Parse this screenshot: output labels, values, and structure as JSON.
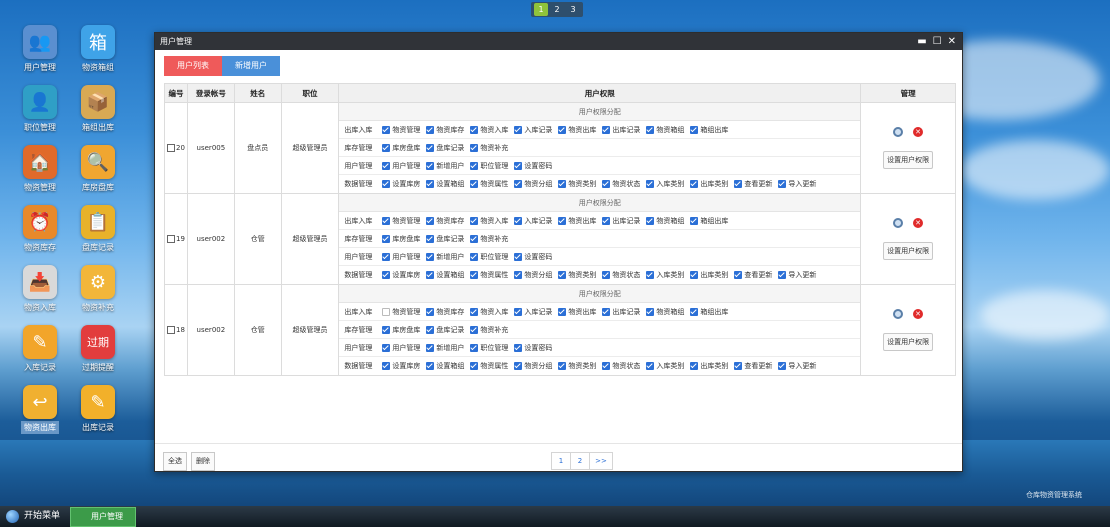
{
  "desktop": {
    "icons": [
      {
        "label": "用户管理",
        "glyph": "👥",
        "color": "#5a8fd0"
      },
      {
        "label": "物资箱组",
        "glyph": "箱",
        "color": "#3fa3e8"
      },
      {
        "label": "职位管理",
        "glyph": "👤",
        "color": "#2f9fc6"
      },
      {
        "label": "箱组出库",
        "glyph": "📦",
        "color": "#d8a954"
      },
      {
        "label": "物资管理",
        "glyph": "🏠",
        "color": "#e06a2a"
      },
      {
        "label": "库房盘库",
        "glyph": "🔍",
        "color": "#f0a630"
      },
      {
        "label": "物资库存",
        "glyph": "⏰",
        "color": "#e8892a"
      },
      {
        "label": "盘库记录",
        "glyph": "📋",
        "color": "#e8b22a"
      },
      {
        "label": "物资入库",
        "glyph": "📥",
        "color": "#d9d9d9"
      },
      {
        "label": "物资补充",
        "glyph": "⚙",
        "color": "#f2b63a"
      },
      {
        "label": "入库记录",
        "glyph": "✎",
        "color": "#f2a52a"
      },
      {
        "label": "过期提醒",
        "glyph": "过期",
        "color": "#e23d3d"
      },
      {
        "label": "物资出库",
        "glyph": "↩",
        "color": "#f0b030"
      },
      {
        "label": "出库记录",
        "glyph": "✎",
        "color": "#f2b02a"
      }
    ]
  },
  "top_pager": [
    "1",
    "2",
    "3"
  ],
  "window": {
    "title": "用户管理",
    "controls": [
      "▬",
      "☐",
      "✕"
    ],
    "tabs": [
      "用户列表",
      "新增用户"
    ],
    "headers": [
      "编号",
      "登录帐号",
      "姓名",
      "职位",
      "用户权限",
      "管理"
    ],
    "perm_title": "用户权限分配",
    "rows": [
      {
        "id": "20",
        "account": "user005",
        "name": "盘点员",
        "position": "超级管理员",
        "perms": [
          {
            "cat": "出库入库",
            "items": [
              [
                "物资管理",
                1
              ],
              [
                "物资库存",
                1
              ],
              [
                "物资入库",
                1
              ],
              [
                "入库记录",
                1
              ],
              [
                "物资出库",
                1
              ],
              [
                "出库记录",
                1
              ],
              [
                "物资箱组",
                1
              ],
              [
                "箱组出库",
                1
              ]
            ]
          },
          {
            "cat": "库存管理",
            "items": [
              [
                "库房盘库",
                1
              ],
              [
                "盘库记录",
                1
              ],
              [
                "物资补充",
                1
              ]
            ]
          },
          {
            "cat": "用户管理",
            "items": [
              [
                "用户管理",
                1
              ],
              [
                "新增用户",
                1
              ],
              [
                "职位管理",
                1
              ],
              [
                "设置密码",
                1
              ]
            ]
          },
          {
            "cat": "数据管理",
            "items": [
              [
                "设置库房",
                1
              ],
              [
                "设置箱组",
                1
              ],
              [
                "物资属性",
                1
              ],
              [
                "物资分组",
                1
              ],
              [
                "物资类别",
                1
              ],
              [
                "物资状态",
                1
              ],
              [
                "入库类别",
                1
              ],
              [
                "出库类别",
                1
              ],
              [
                "查看更新",
                1
              ],
              [
                "导入更新",
                1
              ]
            ]
          }
        ]
      },
      {
        "id": "19",
        "account": "user002",
        "name": "仓管",
        "position": "超级管理员",
        "perms": [
          {
            "cat": "出库入库",
            "items": [
              [
                "物资管理",
                1
              ],
              [
                "物资库存",
                1
              ],
              [
                "物资入库",
                1
              ],
              [
                "入库记录",
                1
              ],
              [
                "物资出库",
                1
              ],
              [
                "出库记录",
                1
              ],
              [
                "物资箱组",
                1
              ],
              [
                "箱组出库",
                1
              ]
            ]
          },
          {
            "cat": "库存管理",
            "items": [
              [
                "库房盘库",
                1
              ],
              [
                "盘库记录",
                1
              ],
              [
                "物资补充",
                1
              ]
            ]
          },
          {
            "cat": "用户管理",
            "items": [
              [
                "用户管理",
                1
              ],
              [
                "新增用户",
                1
              ],
              [
                "职位管理",
                1
              ],
              [
                "设置密码",
                1
              ]
            ]
          },
          {
            "cat": "数据管理",
            "items": [
              [
                "设置库房",
                1
              ],
              [
                "设置箱组",
                1
              ],
              [
                "物资属性",
                1
              ],
              [
                "物资分组",
                1
              ],
              [
                "物资类别",
                1
              ],
              [
                "物资状态",
                1
              ],
              [
                "入库类别",
                1
              ],
              [
                "出库类别",
                1
              ],
              [
                "查看更新",
                1
              ],
              [
                "导入更新",
                1
              ]
            ]
          }
        ]
      },
      {
        "id": "18",
        "account": "user002",
        "name": "仓管",
        "position": "超级管理员",
        "perms": [
          {
            "cat": "出库入库",
            "items": [
              [
                "物资管理",
                0
              ],
              [
                "物资库存",
                1
              ],
              [
                "物资入库",
                1
              ],
              [
                "入库记录",
                1
              ],
              [
                "物资出库",
                1
              ],
              [
                "出库记录",
                1
              ],
              [
                "物资箱组",
                1
              ],
              [
                "箱组出库",
                1
              ]
            ]
          },
          {
            "cat": "库存管理",
            "items": [
              [
                "库房盘库",
                1
              ],
              [
                "盘库记录",
                1
              ],
              [
                "物资补充",
                1
              ]
            ]
          },
          {
            "cat": "用户管理",
            "items": [
              [
                "用户管理",
                1
              ],
              [
                "新增用户",
                1
              ],
              [
                "职位管理",
                1
              ],
              [
                "设置密码",
                1
              ]
            ]
          },
          {
            "cat": "数据管理",
            "items": [
              [
                "设置库房",
                1
              ],
              [
                "设置箱组",
                1
              ],
              [
                "物资属性",
                1
              ],
              [
                "物资分组",
                1
              ],
              [
                "物资类别",
                1
              ],
              [
                "物资状态",
                1
              ],
              [
                "入库类别",
                1
              ],
              [
                "出库类别",
                1
              ],
              [
                "查看更新",
                1
              ],
              [
                "导入更新",
                1
              ]
            ]
          }
        ]
      }
    ],
    "set_perm_label": "设置用户权限",
    "footer": {
      "select_all": "全选",
      "delete": "删除",
      "pages": [
        "1",
        "2",
        ">>"
      ]
    }
  },
  "taskbar": {
    "start_label": "开始菜单",
    "task_label": "用户管理"
  },
  "brand": "仓库物资管理系统"
}
